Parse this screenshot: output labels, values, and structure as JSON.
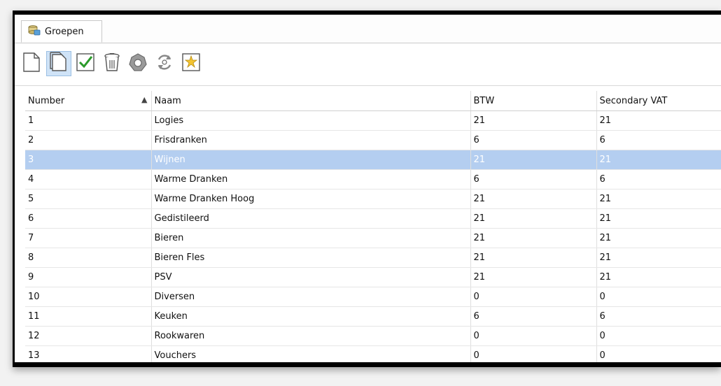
{
  "tab": {
    "label": "Groepen",
    "icon": "database-group-icon"
  },
  "toolbar": {
    "buttons": [
      {
        "name": "new-button",
        "icon": "new-document-icon"
      },
      {
        "name": "edit-button",
        "icon": "edit-document-icon"
      },
      {
        "name": "confirm-button",
        "icon": "checkmark-icon"
      },
      {
        "name": "delete-button",
        "icon": "trash-icon"
      },
      {
        "name": "settings-button",
        "icon": "gear-icon"
      },
      {
        "name": "refresh-button",
        "icon": "refresh-icon"
      },
      {
        "name": "favorite-button",
        "icon": "star-icon"
      }
    ]
  },
  "table": {
    "columns": [
      "Number",
      "Naam",
      "BTW",
      "Secondary VAT"
    ],
    "sort": {
      "column": "Number",
      "direction": "asc"
    },
    "selected_row": 2,
    "rows": [
      [
        "1",
        "Logies",
        "21",
        "21"
      ],
      [
        "2",
        "Frisdranken",
        "6",
        "6"
      ],
      [
        "3",
        "Wijnen",
        "21",
        "21"
      ],
      [
        "4",
        "Warme Dranken",
        "6",
        "6"
      ],
      [
        "5",
        "Warme Dranken Hoog",
        "21",
        "21"
      ],
      [
        "6",
        "Gedistileerd",
        "21",
        "21"
      ],
      [
        "7",
        "Bieren",
        "21",
        "21"
      ],
      [
        "8",
        "Bieren Fles",
        "21",
        "21"
      ],
      [
        "9",
        "PSV",
        "21",
        "21"
      ],
      [
        "10",
        "Diversen",
        "0",
        "0"
      ],
      [
        "11",
        "Keuken",
        "6",
        "6"
      ],
      [
        "12",
        "Rookwaren",
        "0",
        "0"
      ],
      [
        "13",
        "Vouchers",
        "0",
        "0"
      ]
    ]
  },
  "colors": {
    "selection": "#b4cef0",
    "frame": "#000000"
  }
}
